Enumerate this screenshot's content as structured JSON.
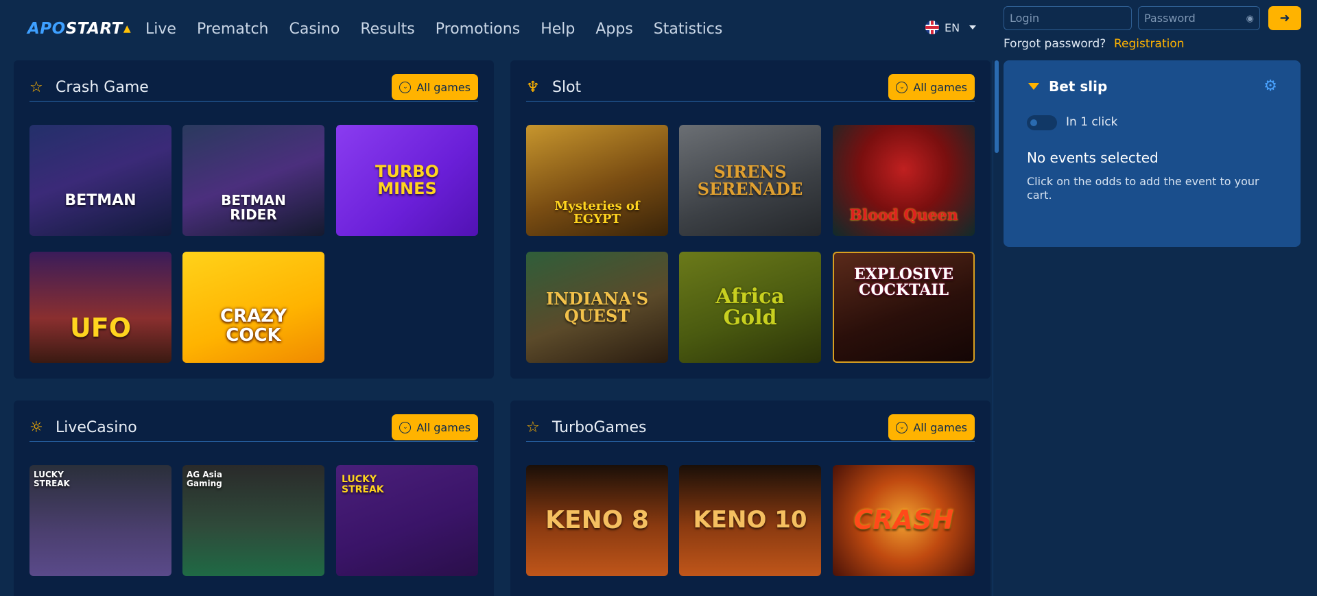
{
  "brand": {
    "part1": "APO",
    "part2": "START"
  },
  "nav": [
    "Live",
    "Prematch",
    "Casino",
    "Results",
    "Promotions",
    "Help",
    "Apps",
    "Statistics"
  ],
  "language": "EN",
  "auth": {
    "login_placeholder": "Login",
    "password_placeholder": "Password",
    "forgot": "Forgot password?",
    "register": "Registration"
  },
  "sections": {
    "crash": {
      "title": "Crash Game",
      "all": "All games",
      "tiles": [
        {
          "label": "BETMAN"
        },
        {
          "label": "BETMAN RIDER"
        },
        {
          "label": "TURBO MINES"
        },
        {
          "label": "UFO"
        },
        {
          "label": "CRAZY COCK"
        }
      ]
    },
    "slot": {
      "title": "Slot",
      "all": "All games",
      "tiles": [
        {
          "label": "Mysteries of EGYPT"
        },
        {
          "label": "SIRENS SERENADE"
        },
        {
          "label": "Blood Queen"
        },
        {
          "label": "INDIANA'S QUEST"
        },
        {
          "label": "Africa Gold"
        },
        {
          "label": "EXPLOSIVE COCKTAIL"
        }
      ]
    },
    "live": {
      "title": "LiveCasino",
      "all": "All games",
      "tiles": [
        {
          "label": "LUCKY STREAK"
        },
        {
          "label": "AG Asia Gaming"
        },
        {
          "label": "LUCKY STREAK"
        }
      ]
    },
    "turbo": {
      "title": "TurboGames",
      "all": "All games",
      "tiles": [
        {
          "label": "KENO 8"
        },
        {
          "label": "KENO 10"
        },
        {
          "label": "CRASH"
        }
      ]
    }
  },
  "betslip": {
    "title": "Bet slip",
    "one_click": "In 1 click",
    "empty_title": "No events selected",
    "empty_hint": "Click on the odds to add the event to your cart."
  },
  "colors": {
    "accent": "#ffb300",
    "bg": "#0d2a4d",
    "panel": "#092043",
    "slip": "#1a4e8c"
  }
}
